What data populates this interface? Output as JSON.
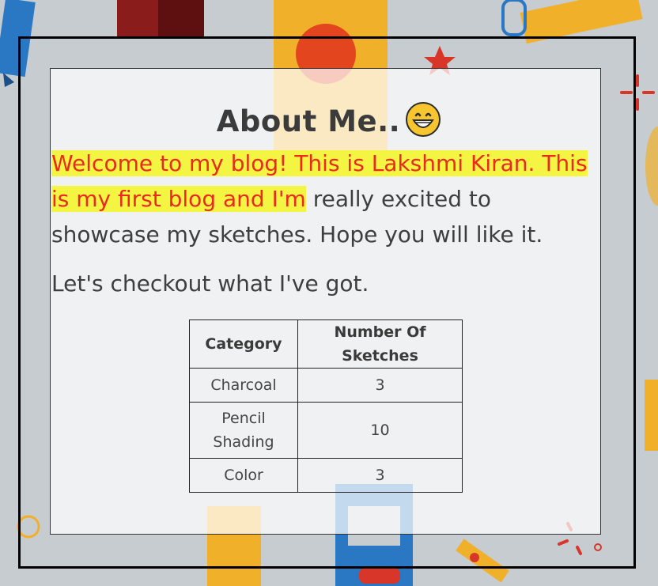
{
  "page": {
    "title": "About Me..",
    "emoji": "grinning-face",
    "intro_highlighted": "Welcome to my blog! This is Lakshmi Kiran. This is my first blog and I'm",
    "intro_rest": " really excited to showcase my sketches. Hope you will like it.",
    "subtitle": "Let's checkout what I've got."
  },
  "table": {
    "headers": [
      "Category",
      "Number Of Sketches"
    ],
    "rows": [
      [
        "Charcoal",
        "3"
      ],
      [
        "Pencil Shading",
        "10"
      ],
      [
        "Color",
        "3"
      ]
    ]
  },
  "colors": {
    "highlight": "#f4f442",
    "highlight_text": "#ea2a1f",
    "text": "#3e3e3e"
  }
}
